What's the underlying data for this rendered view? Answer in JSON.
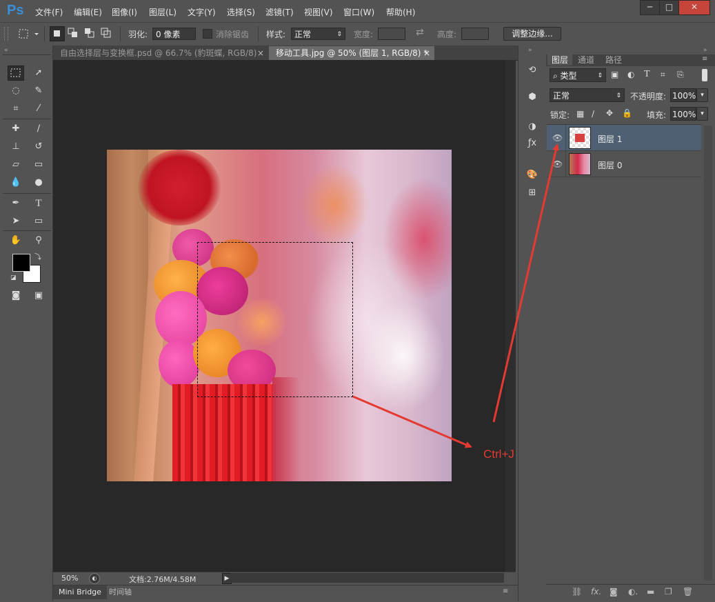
{
  "app": {
    "logo": "Ps"
  },
  "menu": [
    "文件(F)",
    "编辑(E)",
    "图像(I)",
    "图层(L)",
    "文字(Y)",
    "选择(S)",
    "滤镜(T)",
    "视图(V)",
    "窗口(W)",
    "帮助(H)"
  ],
  "window_controls": {
    "minimize": "─",
    "maximize": "□",
    "close": "✕"
  },
  "options": {
    "feather_label": "羽化:",
    "feather_value": "0 像素",
    "antialias_label": "消除锯齿",
    "style_label": "样式:",
    "style_value": "正常",
    "width_label": "宽度:",
    "height_label": "高度:",
    "refine_edge_button": "调整边缘..."
  },
  "tabs": [
    {
      "label": "自由选择层与变换框.psd @ 66.7% (豹斑蝶, RGB/8)",
      "active": false
    },
    {
      "label": "移动工具.jpg @ 50% (图层 1, RGB/8) *",
      "active": true
    }
  ],
  "tab_close": "×",
  "status": {
    "zoom": "50%",
    "doc_info": "文档:2.76M/4.58M"
  },
  "bottom_tabs": [
    "Mini Bridge",
    "时间轴"
  ],
  "layers_panel": {
    "tabs": [
      "图层",
      "通道",
      "路径"
    ],
    "filter_kind": "类型",
    "blend_mode": "正常",
    "opacity_label": "不透明度:",
    "opacity_value": "100%",
    "lock_label": "锁定:",
    "fill_label": "填充:",
    "fill_value": "100%",
    "layers": [
      {
        "name": "图层 1",
        "selected": true
      },
      {
        "name": "图层 0",
        "selected": false
      }
    ]
  },
  "annotation": {
    "text": "Ctrl+J",
    "color": "#e33b32"
  },
  "colors": {
    "ui_bg": "#535353",
    "canvas_bg": "#282828",
    "selected_layer": "#4f6072",
    "logo": "#3a8fd8"
  }
}
